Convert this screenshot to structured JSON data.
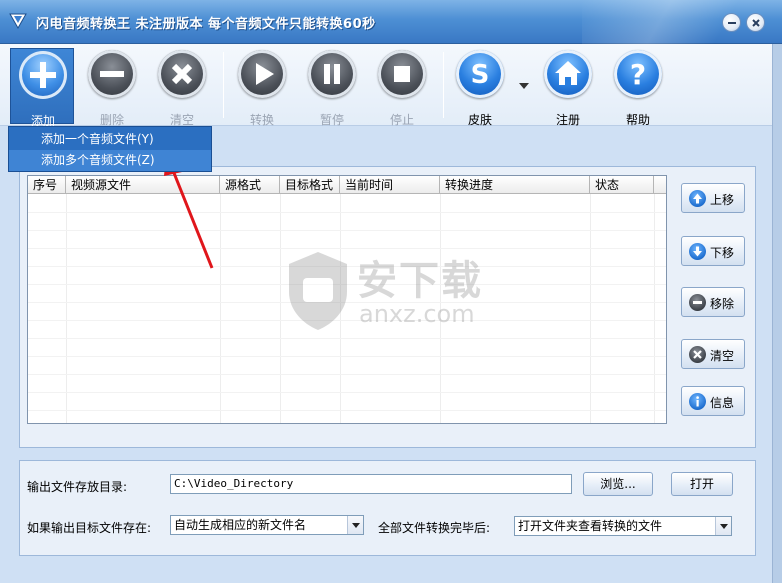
{
  "title": "闪电音频转换王  未注册版本 每个音频文件只能转换60秒",
  "toolbar": {
    "add": "添加",
    "delete": "删除",
    "clear": "清空",
    "convert": "转换",
    "pause": "暂停",
    "stop": "停止",
    "skin": "皮肤",
    "register": "注册",
    "help": "帮助"
  },
  "menu": {
    "item1": "添加一个音频文件(Y)",
    "item2": "添加多个音频文件(Z)"
  },
  "table": {
    "columns": [
      "序号",
      "视频源文件",
      "源格式",
      "目标格式",
      "当前时间",
      "转换进度",
      "状态"
    ]
  },
  "side": {
    "up": "上移",
    "down": "下移",
    "remove": "移除",
    "clear": "清空",
    "info": "信息"
  },
  "watermark": {
    "cn": "安下载",
    "en": "anxz.com"
  },
  "output": {
    "dir_label": "输出文件存放目录:",
    "dir_value": "C:\\Video_Directory",
    "browse": "浏览...",
    "open": "打开",
    "exists_label": "如果输出目标文件存在:",
    "exists_value": "自动生成相应的新文件名",
    "after_label": "全部文件转换完毕后:",
    "after_value": "打开文件夹查看转换的文件"
  }
}
